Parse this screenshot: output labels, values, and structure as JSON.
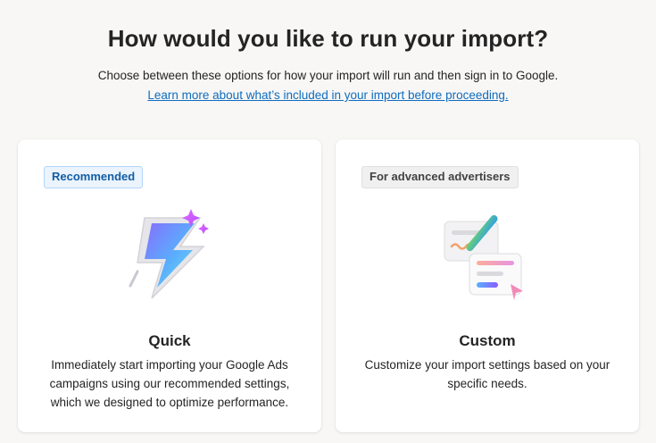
{
  "header": {
    "title": "How would you like to run your import?",
    "subtitle": "Choose between these options for how your import will run and then sign in to Google.",
    "learn_more": "Learn more about what’s included in your import before proceeding."
  },
  "options": [
    {
      "badge": "Recommended",
      "title": "Quick",
      "description": "Immediately start importing your Google Ads campaigns using our recommended settings, which we designed to optimize performance.",
      "icon": "lightning-bolt-icon"
    },
    {
      "badge": "For advanced advertisers",
      "title": "Custom",
      "description": "Customize your import settings based on your specific needs.",
      "icon": "settings-pencil-icon"
    }
  ],
  "colors": {
    "link": "#0f6cbd",
    "recommended_badge_bg": "#ebf3fc",
    "recommended_badge_text": "#115ea3",
    "advanced_badge_bg": "#f0f0f0"
  }
}
